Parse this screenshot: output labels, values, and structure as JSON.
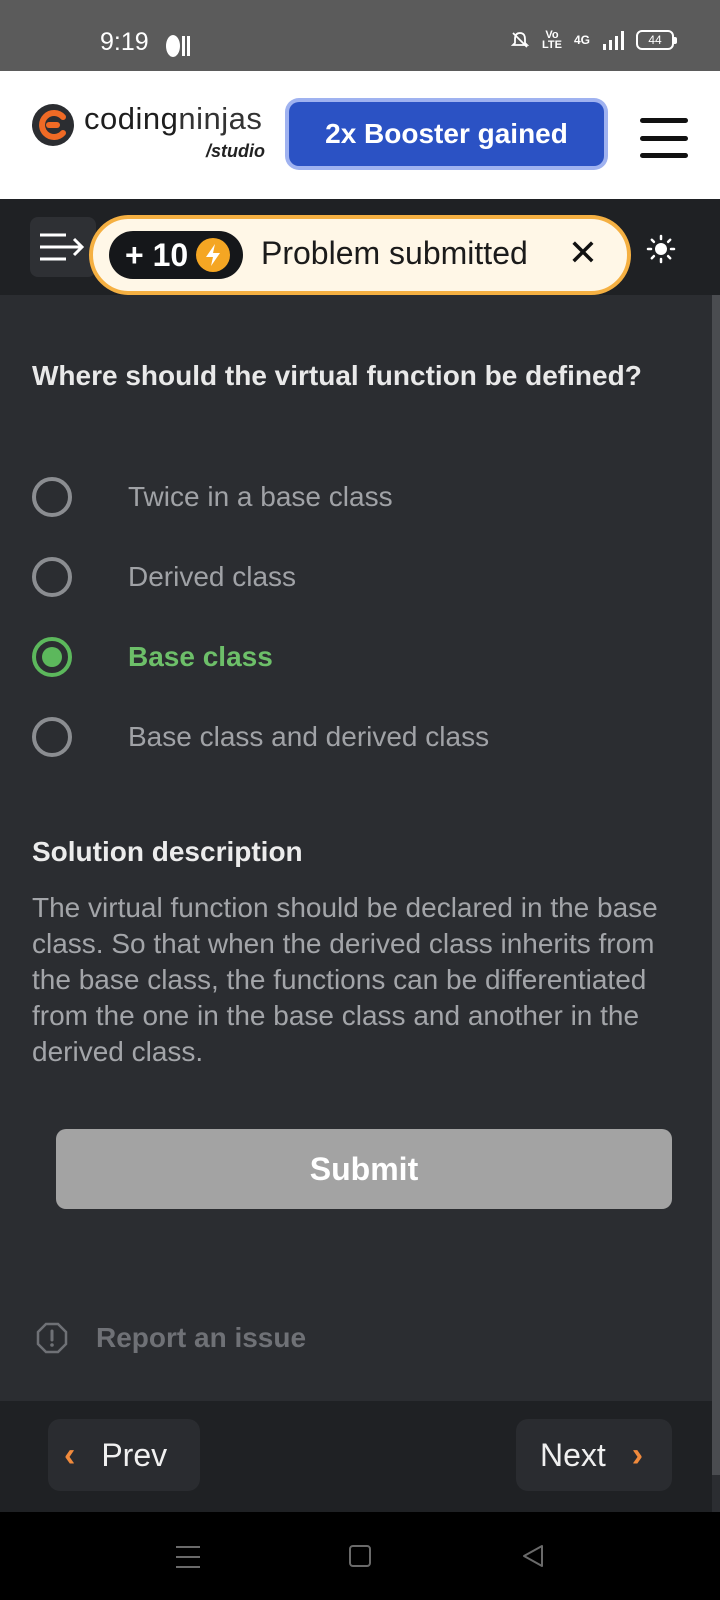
{
  "status_bar": {
    "time": "9:19",
    "volte": "Vo\nLTE",
    "network": "4G",
    "battery": "44"
  },
  "header": {
    "logo_bold": "coding",
    "logo_light": "ninjas",
    "logo_sub": "/studio",
    "booster_label": "2x Booster gained",
    "brand_color": "#2b52c4"
  },
  "toast": {
    "points": "+ 10",
    "message": "Problem submitted",
    "close": "✕",
    "border_color": "#f5b042"
  },
  "question": {
    "text": "Where should the virtual function be defined?",
    "options": [
      {
        "label": "Twice in a base class",
        "selected": false
      },
      {
        "label": "Derived class",
        "selected": false
      },
      {
        "label": "Base class",
        "selected": true
      },
      {
        "label": "Base class and derived class",
        "selected": false
      }
    ],
    "selected_color": "#5cb85c"
  },
  "solution": {
    "title": "Solution description",
    "text": "The virtual function should be declared in the base class. So that when the derived class inherits from the base class, the functions can be differentiated from the one in the base class and another in the derived class."
  },
  "actions": {
    "submit_label": "Submit",
    "report_label": "Report an issue"
  },
  "navigation": {
    "prev_label": "Prev",
    "next_label": "Next",
    "accent_color": "#f08a3c"
  },
  "icons": {
    "menu_toggle": "sidebar-toggle-icon",
    "theme": "sun-icon",
    "bolt": "lightning-bolt-icon",
    "report": "alert-octagon-icon"
  }
}
